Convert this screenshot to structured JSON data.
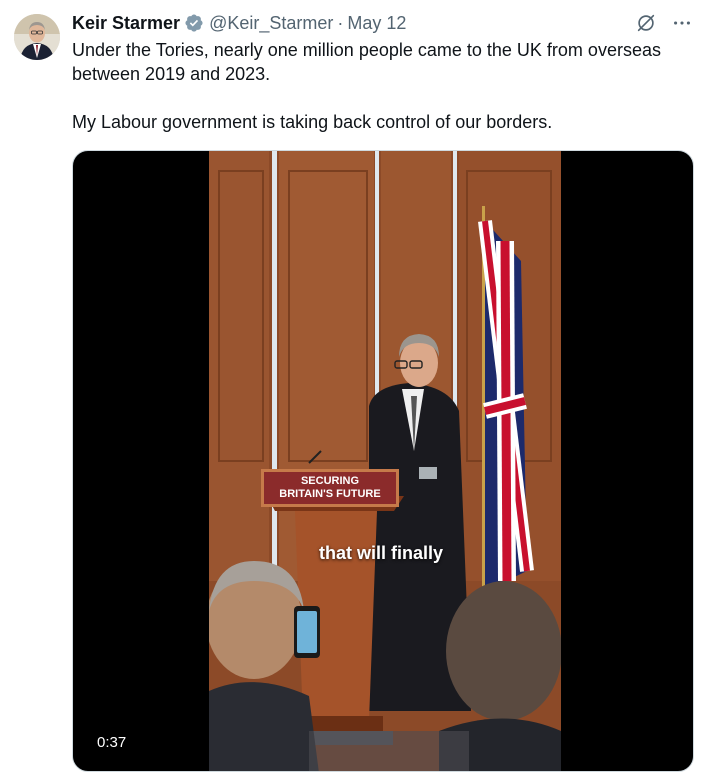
{
  "author": {
    "name": "Keir Starmer",
    "handle": "@Keir_Starmer",
    "separator": "·",
    "date": "May 12",
    "verified_color": "#829aab"
  },
  "icons": {
    "verified": "verified-badge-icon",
    "grok": "grok-icon",
    "more": "more-icon"
  },
  "tweet": {
    "paragraph_1": "Under the Tories, nearly one million people came to the UK from overseas between 2019 and 2023.",
    "paragraph_2": "My Labour government is taking back control of our borders."
  },
  "video": {
    "timecode": "0:37",
    "caption": "that will finally",
    "podium_sign_line_1": "SECURING",
    "podium_sign_line_2": "BRITAIN'S FUTURE"
  },
  "colors": {
    "text_primary": "#0f1419",
    "text_secondary": "#536471",
    "media_border": "#cfd9de",
    "podium_sign": "#8b2b2b"
  }
}
